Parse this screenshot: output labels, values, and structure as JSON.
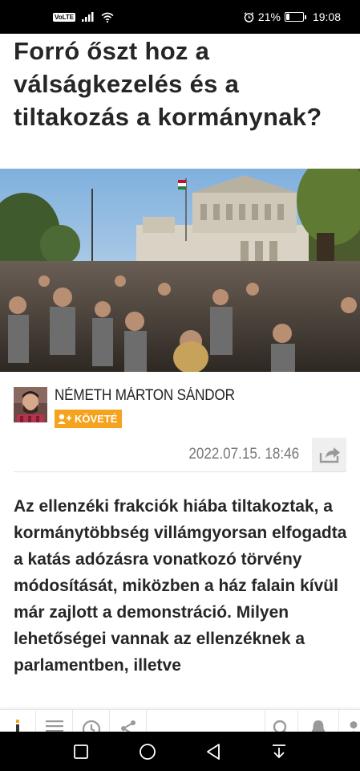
{
  "status_bar": {
    "volte": "VoLTE",
    "battery_percent": "21%",
    "battery_level": 0.21,
    "time": "19:08"
  },
  "article": {
    "title": "Forró őszt hoz a válságkezelés és a tiltakozás a kormánynak?",
    "author_name": "NÉMETH MÁRTON SÁNDOR",
    "follow_label": "KÖVETÉ",
    "date": "2022.07.15. 18:46",
    "lead": "Az ellenzéki frakciók hiába tiltakoztak, a kormánytöbbség villámgyorsan elfogadta a katás adózásra vonatkozó törvény módosítását, miközben a ház falain kívül már zajlott a demonstráció. Milyen lehetőségei vannak az ellenzéknek a parlamentben, illetve"
  },
  "colors": {
    "accent": "#f5a21c",
    "text": "#262626",
    "muted": "#777777"
  },
  "toolbar": {
    "icons": [
      "logo-icon",
      "menu-icon",
      "history-icon",
      "share-icon",
      "search-icon",
      "notification-icon",
      "profile-icon"
    ]
  },
  "navbar": {
    "icons": [
      "recent-apps-icon",
      "home-icon",
      "back-icon",
      "notification-pull-icon"
    ]
  }
}
